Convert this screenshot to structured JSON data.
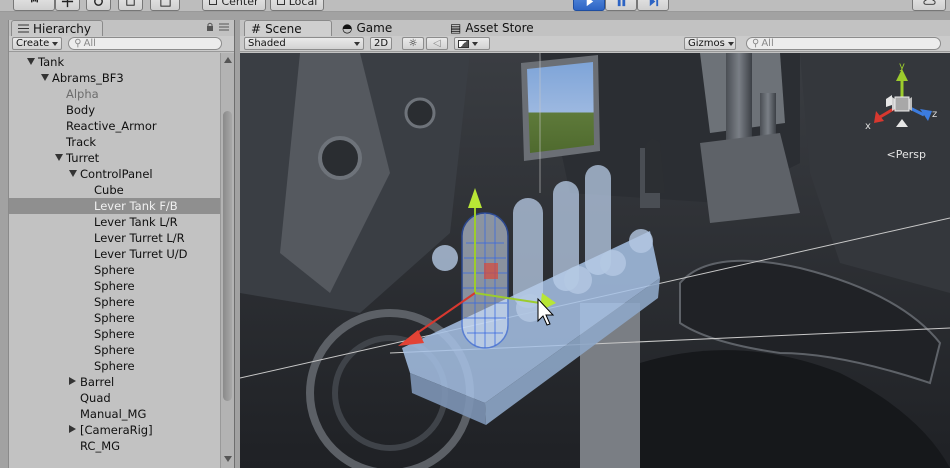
{
  "toolbar": {
    "center_label": "Center",
    "local_label": "Local"
  },
  "hierarchy": {
    "tab_label": "Hierarchy",
    "create_label": "Create",
    "search_placeholder": "All",
    "items": [
      {
        "label": "Tank",
        "depth": 0,
        "arrow": "down"
      },
      {
        "label": "Abrams_BF3",
        "depth": 1,
        "arrow": "down"
      },
      {
        "label": "Alpha",
        "depth": 2,
        "arrow": "",
        "inactive": true
      },
      {
        "label": "Body",
        "depth": 2,
        "arrow": ""
      },
      {
        "label": "Reactive_Armor",
        "depth": 2,
        "arrow": ""
      },
      {
        "label": "Track",
        "depth": 2,
        "arrow": ""
      },
      {
        "label": "Turret",
        "depth": 2,
        "arrow": "down"
      },
      {
        "label": "ControlPanel",
        "depth": 3,
        "arrow": "down"
      },
      {
        "label": "Cube",
        "depth": 4,
        "arrow": ""
      },
      {
        "label": "Lever Tank F/B",
        "depth": 4,
        "arrow": "",
        "selected": true
      },
      {
        "label": "Lever Tank L/R",
        "depth": 4,
        "arrow": ""
      },
      {
        "label": "Lever Turret L/R",
        "depth": 4,
        "arrow": ""
      },
      {
        "label": "Lever Turret U/D",
        "depth": 4,
        "arrow": ""
      },
      {
        "label": "Sphere",
        "depth": 4,
        "arrow": ""
      },
      {
        "label": "Sphere",
        "depth": 4,
        "arrow": ""
      },
      {
        "label": "Sphere",
        "depth": 4,
        "arrow": ""
      },
      {
        "label": "Sphere",
        "depth": 4,
        "arrow": ""
      },
      {
        "label": "Sphere",
        "depth": 4,
        "arrow": ""
      },
      {
        "label": "Sphere",
        "depth": 4,
        "arrow": ""
      },
      {
        "label": "Sphere",
        "depth": 4,
        "arrow": ""
      },
      {
        "label": "Barrel",
        "depth": 3,
        "arrow": "right"
      },
      {
        "label": "Quad",
        "depth": 3,
        "arrow": ""
      },
      {
        "label": "Manual_MG",
        "depth": 3,
        "arrow": ""
      },
      {
        "label": "[CameraRig]",
        "depth": 3,
        "arrow": "right"
      },
      {
        "label": "RC_MG",
        "depth": 3,
        "arrow": ""
      }
    ]
  },
  "scene": {
    "tabs": [
      {
        "label": "Scene",
        "icon": "grid-icon",
        "active": true
      },
      {
        "label": "Game",
        "icon": "game-icon",
        "active": false
      },
      {
        "label": "Asset Store",
        "icon": "store-icon",
        "active": false
      }
    ],
    "shading_label": "Shaded",
    "mode_2d_label": "2D",
    "gizmos_label": "Gizmos",
    "search_placeholder": "All",
    "persp_label": "Persp",
    "axis_labels": {
      "x": "x",
      "y": "y",
      "z": "z"
    }
  },
  "colors": {
    "play_blue": "#3a74d6",
    "axis_x": "#d8382f",
    "axis_y": "#9ccc2c",
    "axis_z": "#3c7ce0",
    "selected_row": "#8f8f8f"
  }
}
